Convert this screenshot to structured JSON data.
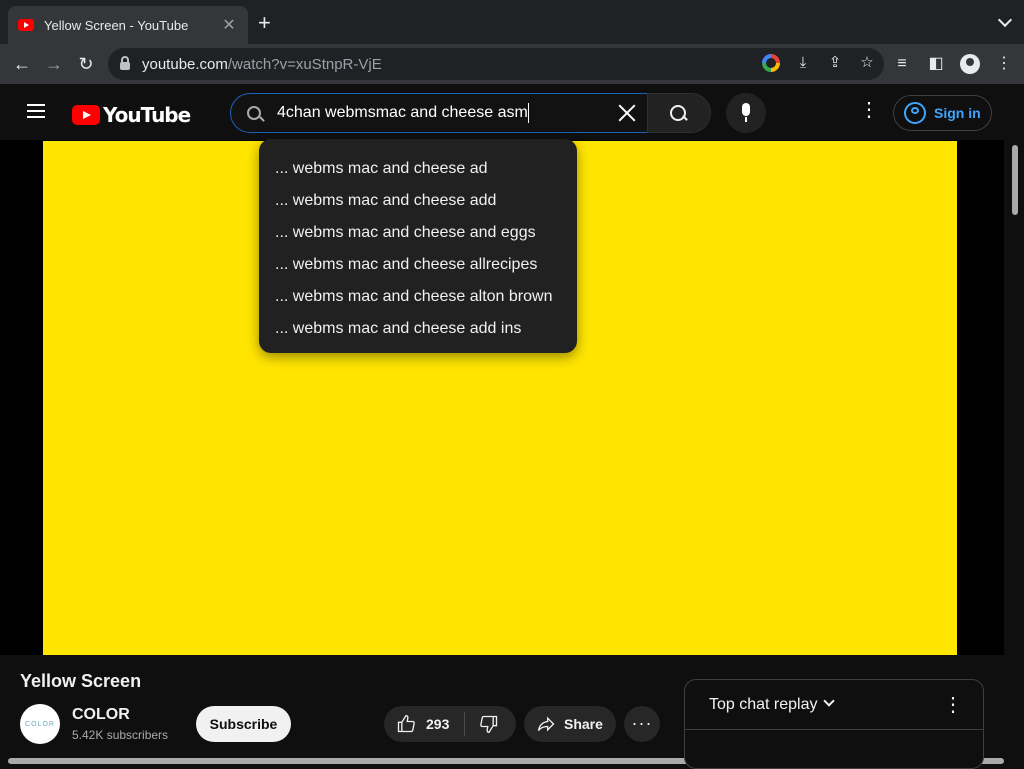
{
  "browser": {
    "tab_title": "Yellow Screen - YouTube",
    "tab_close": "✕",
    "new_tab": "+",
    "url_host": "youtube.com",
    "url_path": "/watch?v=xuStnpR-VjE"
  },
  "header": {
    "logo_text": "YouTube",
    "search_value": "4chan webmsmac and cheese asm",
    "signin_label": "Sign in"
  },
  "suggestions": [
    "... webms mac and cheese ad",
    "... webms mac and cheese add",
    "... webms mac and cheese and eggs",
    "... webms mac and cheese allrecipes",
    "... webms mac and cheese alton brown",
    "... webms mac and cheese add ins"
  ],
  "video": {
    "title": "Yellow Screen",
    "color": "#ffe500"
  },
  "channel": {
    "avatar_text": "COLOR",
    "name": "COLOR",
    "subscribers": "5.42K subscribers",
    "subscribe_label": "Subscribe"
  },
  "actions": {
    "like_count": "293",
    "share_label": "Share",
    "more_label": "···"
  },
  "chat": {
    "title": "Top chat replay"
  },
  "colors": {
    "accent_link": "#3ea6ff",
    "youtube_red": "#ff0000",
    "background": "#0f0f0f"
  }
}
